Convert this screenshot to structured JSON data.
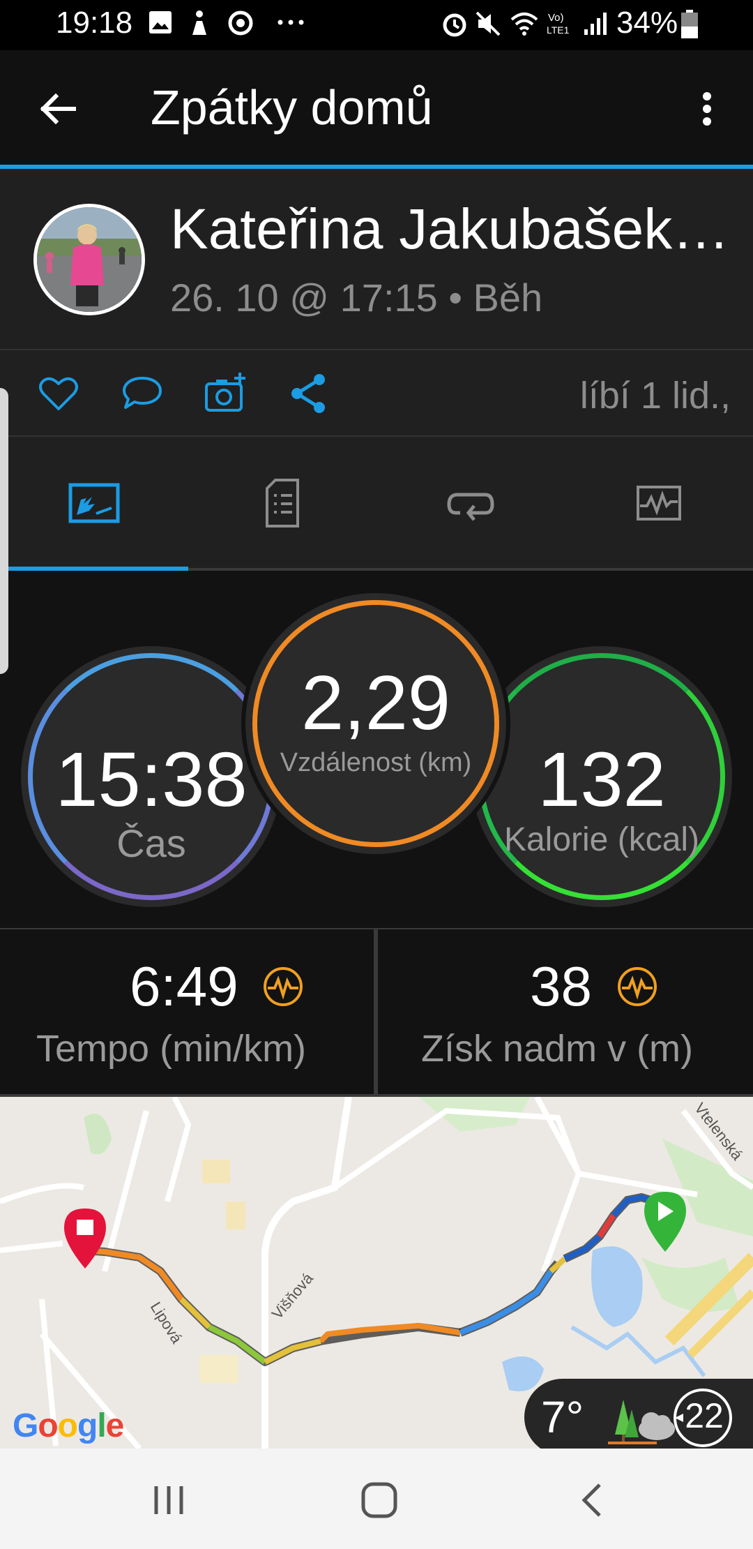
{
  "status_bar": {
    "time": "19:18",
    "battery": "34%",
    "icons": [
      "image-icon",
      "accessibility-icon",
      "sync-icon",
      "more-dots-icon",
      "alarm-icon",
      "mute-icon",
      "wifi-icon",
      "volte-icon",
      "signal-icon",
      "battery-icon"
    ]
  },
  "app_bar": {
    "title": "Zpátky domů",
    "back_icon": "arrow-left-icon",
    "menu_icon": "more-vert-icon",
    "accent": "#1b9ce3"
  },
  "header": {
    "name": "Kateřina Jakubašek…",
    "subtitle": "26. 10 @ 17:15 • Běh"
  },
  "actions": {
    "icons": [
      "heart-icon",
      "comment-icon",
      "camera-add-icon",
      "share-icon"
    ],
    "likes_text": "líbí 1 lid.,"
  },
  "tabs": [
    {
      "name": "overview",
      "icon": "overview-icon",
      "active": true
    },
    {
      "name": "details",
      "icon": "document-icon",
      "active": false
    },
    {
      "name": "laps",
      "icon": "loop-icon",
      "active": false
    },
    {
      "name": "charts",
      "icon": "chart-icon",
      "active": false
    }
  ],
  "stats": {
    "time": {
      "value": "15:38",
      "label": "Čas",
      "color": "#5b8fdc"
    },
    "distance": {
      "value": "2,29",
      "label": "Vzdálenost (km)",
      "color": "#f08a24"
    },
    "calories": {
      "value": "132",
      "label": "Kalorie (kcal)",
      "color": "#22c93e"
    }
  },
  "cells": {
    "pace": {
      "value": "6:49",
      "label": "Tempo (min/km)",
      "icon": "pulse-icon"
    },
    "elevation": {
      "value": "38",
      "label": "Získ nadm v (m)",
      "icon": "pulse-icon"
    }
  },
  "map": {
    "streets": [
      "Lipová",
      "Višňová",
      "Vtelenská"
    ],
    "provider": "Google",
    "weather": {
      "temperature": "7°",
      "wind": "22",
      "icon": "weather-tree-cloud-icon"
    }
  },
  "nav_bar": {
    "icons": [
      "recent-apps-icon",
      "home-icon",
      "back-icon"
    ]
  }
}
